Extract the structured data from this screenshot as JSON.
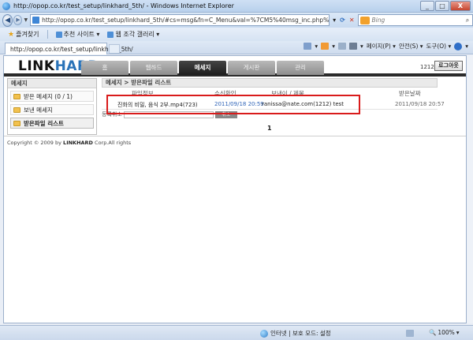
{
  "window": {
    "title": "http://opop.co.kr/test_setup/linkhard_5th/ - Windows Internet Explorer",
    "min": "_",
    "max": "□",
    "close": "X"
  },
  "address": {
    "url": "http://opop.co.kr/test_setup/linkhard_5th/#cs=msg&fn=C_Menu&val=%7CM5%40msg_inc.php%7C",
    "search_placeholder": "Bing"
  },
  "favorites": {
    "favorites_label": "즐겨찾기",
    "suggested_sites": "추천 사이트 ▾",
    "web_slice": "웹 조각 갤러리 ▾"
  },
  "tabbar": {
    "tab_title": "http://opop.co.kr/test_setup/linkhard_5th/",
    "page": "페이지(P) ▾",
    "safety": "안전(S) ▾",
    "tools": "도구(O) ▾"
  },
  "site": {
    "logo_link": "LINK",
    "logo_hard": "HARD",
    "nav": [
      "홈",
      "웹하드",
      "메세지",
      "게시판",
      "관리"
    ],
    "user_num": "1212",
    "logout": "로그아웃"
  },
  "sidebar": {
    "title": "메세지",
    "items": [
      {
        "label": "받은 메세지 (0 / 1)"
      },
      {
        "label": "보낸 메세지"
      },
      {
        "label": "받은파일 리스트"
      }
    ]
  },
  "content": {
    "breadcrumb": "메세지 > 받은파일 리스트",
    "columns": {
      "file_info": "파일정보",
      "confirm": "수신확인",
      "sender_title": "보낸이 / 제목",
      "received_date": "받은날짜"
    },
    "rows": [
      {
        "file_info": "진화의 비밀, 음식 2부.mp4(723)",
        "confirm": "2011/09/18 20:59",
        "sender_title": "ranissa@nate.com(1212) test",
        "received_date": "2011/09/18 20:57"
      }
    ],
    "cancel_label": "등록취소",
    "cancel_button": "취소",
    "pagination": "1"
  },
  "footer": {
    "copyright_prefix": "Copyright ",
    "copyright_symbol": "©",
    "copyright_year": " 2009 by ",
    "copyright_brand": "LINKHARD",
    "copyright_suffix": " Corp.All rights"
  },
  "statusbar": {
    "zone": "인터넷 | 보호 모드: 설정",
    "zoom": "100%",
    "zoom_arrow": "▾"
  }
}
